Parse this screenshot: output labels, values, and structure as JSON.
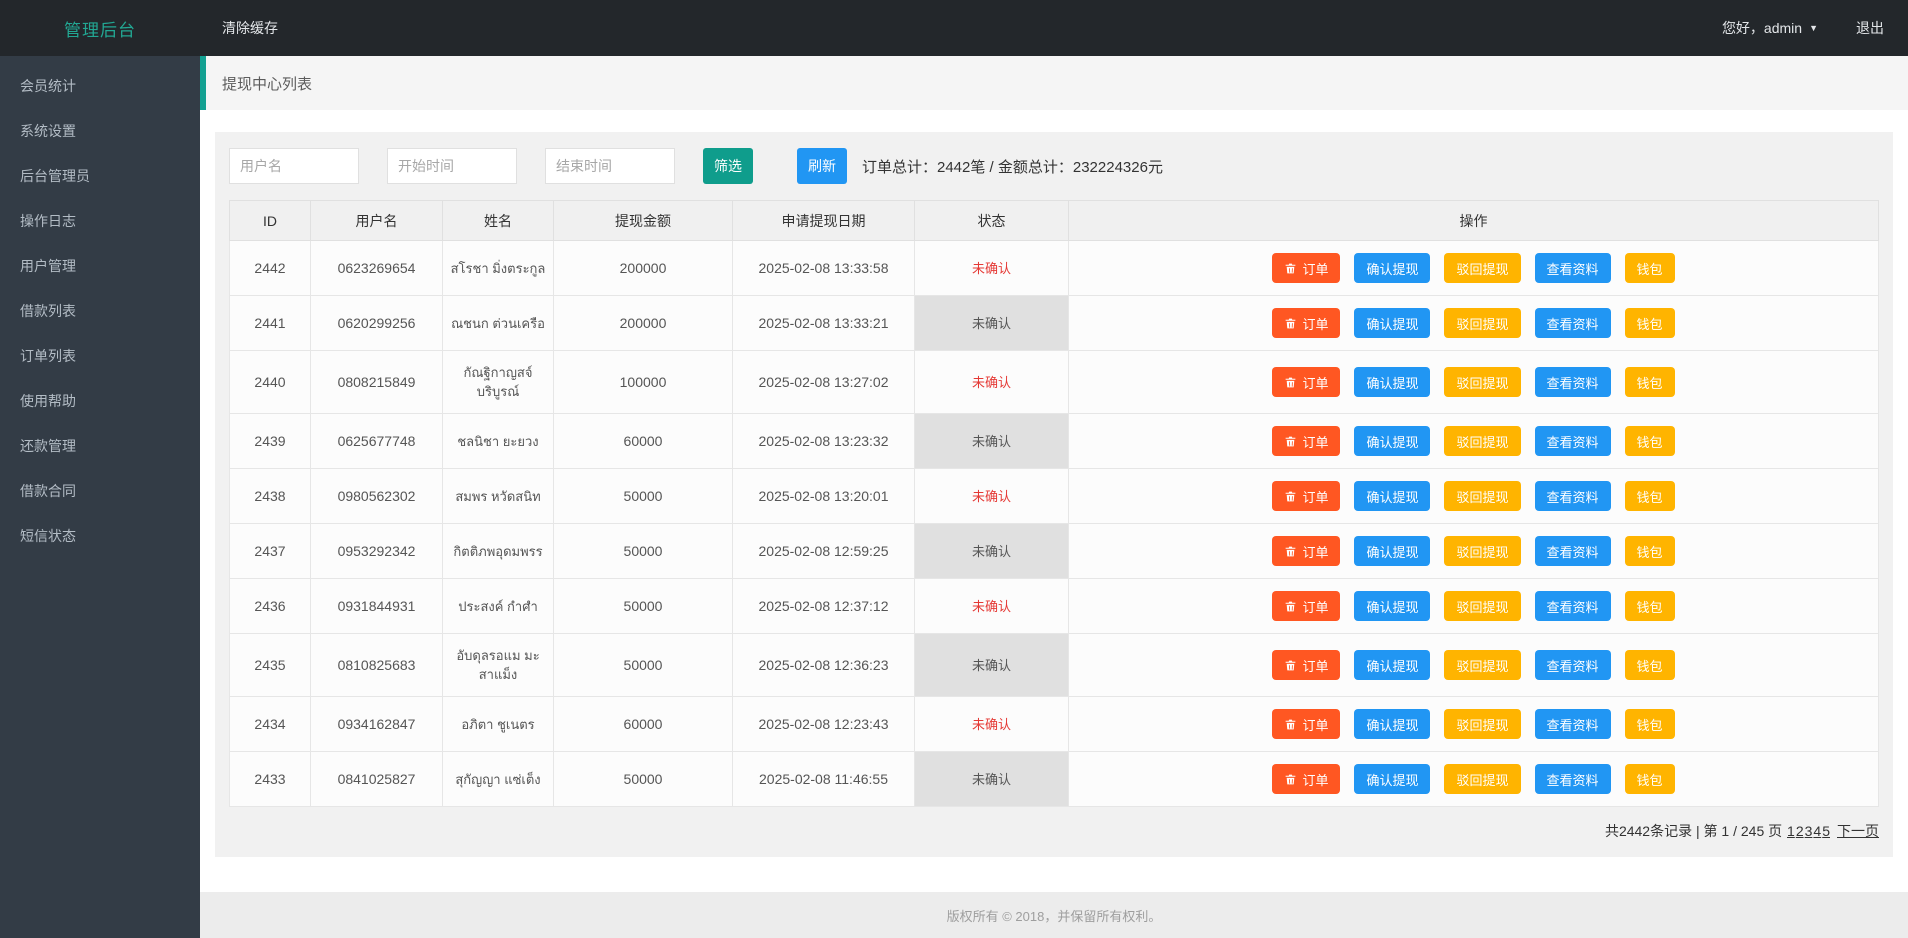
{
  "topbar": {
    "brand": "管理后台",
    "clear_cache": "清除缓存",
    "greeting": "您好，admin",
    "logout": "退出"
  },
  "sidebar": {
    "items": [
      "会员统计",
      "系统设置",
      "后台管理员",
      "操作日志",
      "用户管理",
      "借款列表",
      "订单列表",
      "使用帮助",
      "还款管理",
      "借款合同",
      "短信状态"
    ]
  },
  "breadcrumb": {
    "title": "提现中心列表"
  },
  "filters": {
    "username_placeholder": "用户名",
    "start_placeholder": "开始时间",
    "end_placeholder": "结束时间",
    "filter_button": "筛选",
    "refresh_button": "刷新",
    "summary": "订单总计：2442笔 / 金额总计：232224326元"
  },
  "table": {
    "headers": [
      "ID",
      "用户名",
      "姓名",
      "提现金额",
      "申请提现日期",
      "状态",
      "操作"
    ],
    "action_labels": {
      "order": "订单",
      "confirm": "确认提现",
      "reject": "驳回提现",
      "view": "查看资料",
      "wallet": "钱包"
    },
    "rows": [
      {
        "id": "2442",
        "username": "0623269654",
        "name": "สโรชา มิ่งตระกูล",
        "amount": "200000",
        "date": "2025-02-08 13:33:58",
        "status": "未确认",
        "status_style": "red"
      },
      {
        "id": "2441",
        "username": "0620299256",
        "name": "ณชนก ต่วนเครือ",
        "amount": "200000",
        "date": "2025-02-08 13:33:21",
        "status": "未确认",
        "status_style": "gray"
      },
      {
        "id": "2440",
        "username": "0808215849",
        "name": "กัณฐิกาญสจ์ บริบูรณ์",
        "amount": "100000",
        "date": "2025-02-08 13:27:02",
        "status": "未确认",
        "status_style": "red"
      },
      {
        "id": "2439",
        "username": "0625677748",
        "name": "ชลนิชา ยะยวง",
        "amount": "60000",
        "date": "2025-02-08 13:23:32",
        "status": "未确认",
        "status_style": "gray"
      },
      {
        "id": "2438",
        "username": "0980562302",
        "name": "สมพร หวัดสนิท",
        "amount": "50000",
        "date": "2025-02-08 13:20:01",
        "status": "未确认",
        "status_style": "red"
      },
      {
        "id": "2437",
        "username": "0953292342",
        "name": "กิตติภพอุดมพรร",
        "amount": "50000",
        "date": "2025-02-08 12:59:25",
        "status": "未确认",
        "status_style": "gray"
      },
      {
        "id": "2436",
        "username": "0931844931",
        "name": "ประสงค์ กำศำ",
        "amount": "50000",
        "date": "2025-02-08 12:37:12",
        "status": "未确认",
        "status_style": "red"
      },
      {
        "id": "2435",
        "username": "0810825683",
        "name": "อับดุลรอแม มะสาแม็ง",
        "amount": "50000",
        "date": "2025-02-08 12:36:23",
        "status": "未确认",
        "status_style": "gray"
      },
      {
        "id": "2434",
        "username": "0934162847",
        "name": "อภิตา ชูเนตร",
        "amount": "60000",
        "date": "2025-02-08 12:23:43",
        "status": "未确认",
        "status_style": "red"
      },
      {
        "id": "2433",
        "username": "0841025827",
        "name": "สุกัญญา แซ่เต็ง",
        "amount": "50000",
        "date": "2025-02-08 11:46:55",
        "status": "未确认",
        "status_style": "gray"
      }
    ]
  },
  "pagination": {
    "records": "共2442条记录",
    "separator": "|",
    "page_info": "第 1 / 245 页",
    "pages": [
      "1",
      "2",
      "3",
      "4",
      "5"
    ],
    "next": "下一页"
  },
  "footer": {
    "copyright": "版权所有 © 2018，并保留所有权利。"
  },
  "colors": {
    "accent_teal": "#12a091",
    "button_teal": "#0f9d8c",
    "button_blue": "#2196f3",
    "button_orange": "#ff5722",
    "button_amber": "#ffb400",
    "status_red": "#e53935",
    "status_gray_bg": "#e0e0e0",
    "topbar_bg": "#23272b",
    "sidebar_bg": "#333c46"
  }
}
